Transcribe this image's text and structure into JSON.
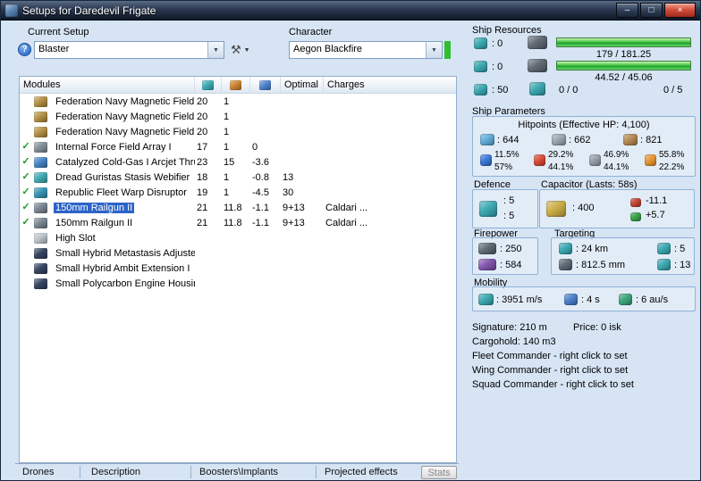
{
  "window": {
    "title": "Setups for Daredevil Frigate"
  },
  "glyphs": {
    "help": "?",
    "tools": "⚒",
    "dropdown": "▼",
    "minimize": "–",
    "maximize": "□",
    "close": "×"
  },
  "toolbar": {
    "current_setup_label": "Current Setup",
    "setup_value": "Blaster",
    "character_label": "Character",
    "character_value": "Aegon Blackfire"
  },
  "modules": {
    "header": {
      "name": "Modules",
      "optimal": "Optimal",
      "charges": "Charges"
    },
    "rows": [
      {
        "check": "",
        "icon_color": "#b08d3e",
        "name": "Federation Navy Magnetic Field ...",
        "cpu": "20",
        "pg": "1",
        "cap": "",
        "optimal": "",
        "charges": ""
      },
      {
        "check": "",
        "icon_color": "#b08d3e",
        "name": "Federation Navy Magnetic Field ...",
        "cpu": "20",
        "pg": "1",
        "cap": "",
        "optimal": "",
        "charges": ""
      },
      {
        "check": "",
        "icon_color": "#b08d3e",
        "name": "Federation Navy Magnetic Field ...",
        "cpu": "20",
        "pg": "1",
        "cap": "",
        "optimal": "",
        "charges": ""
      },
      {
        "check": "✓",
        "icon_color": "#7e8a93",
        "name": "Internal Force Field Array I",
        "cpu": "17",
        "pg": "1",
        "cap": "0",
        "optimal": "",
        "charges": ""
      },
      {
        "check": "✓",
        "icon_color": "#3f7fc2",
        "name": "Catalyzed Cold-Gas I Arcjet Thru...",
        "cpu": "23",
        "pg": "15",
        "cap": "-3.6",
        "optimal": "",
        "charges": ""
      },
      {
        "check": "✓",
        "icon_color": "#3aa7b0",
        "name": "Dread Guristas Stasis Webifier",
        "cpu": "18",
        "pg": "1",
        "cap": "-0.8",
        "optimal": "13",
        "charges": ""
      },
      {
        "check": "✓",
        "icon_color": "#2f8fb0",
        "name": "Republic Fleet Warp Disruptor",
        "cpu": "19",
        "pg": "1",
        "cap": "-4.5",
        "optimal": "30",
        "charges": ""
      },
      {
        "check": "✓",
        "icon_color": "#74828e",
        "name": "150mm Railgun II",
        "cpu": "21",
        "pg": "11.8",
        "cap": "-1.1",
        "optimal": "9+13",
        "charges": "Caldari ..."
      },
      {
        "check": "✓",
        "icon_color": "#74828e",
        "name": "150mm Railgun II",
        "cpu": "21",
        "pg": "11.8",
        "cap": "-1.1",
        "optimal": "9+13",
        "charges": "Caldari ..."
      },
      {
        "check": "",
        "icon_color": "#b9c2c9",
        "name": "High Slot",
        "cpu": "",
        "pg": "",
        "cap": "",
        "optimal": "",
        "charges": ""
      },
      {
        "check": "",
        "icon_color": "#2e3d5c",
        "name": "Small Hybrid Metastasis Adjuster I",
        "cpu": "",
        "pg": "",
        "cap": "",
        "optimal": "",
        "charges": ""
      },
      {
        "check": "",
        "icon_color": "#2e3d5c",
        "name": "Small Hybrid Ambit Extension I",
        "cpu": "",
        "pg": "",
        "cap": "",
        "optimal": "",
        "charges": ""
      },
      {
        "check": "",
        "icon_color": "#2e3d5c",
        "name": "Small Polycarbon Engine Housin...",
        "cpu": "",
        "pg": "",
        "cap": "",
        "optimal": "",
        "charges": ""
      }
    ]
  },
  "tabs": {
    "drones": "Drones",
    "description": "Description",
    "boosters": "Boosters\\Implants",
    "projected": "Projected effects",
    "stats": "Stats"
  },
  "resources": {
    "title": "Ship Resources",
    "turrets_free": ": 0",
    "launchers_free": ": 0",
    "calibration": ": 50",
    "cpu_text": "179 / 181.25",
    "powergrid_text": "44.52 / 45.06",
    "rigs_text": "0 / 0",
    "drones_text": "0 / 5"
  },
  "parameters": {
    "title": "Ship Parameters",
    "hitpoints_title": "Hitpoints (Effective HP: 4,100)",
    "shield_hp": ": 644",
    "armor_hp": ": 662",
    "structure_hp": ": 821",
    "resists": [
      {
        "shield": "11.5%",
        "armor": "57%"
      },
      {
        "shield": "29.2%",
        "armor": "44.1%"
      },
      {
        "shield": "46.9%",
        "armor": "44.1%"
      },
      {
        "shield": "55.8%",
        "armor": "22.2%"
      }
    ]
  },
  "defence": {
    "label": "Defence",
    "shield_recharge": ": 5",
    "armor_repair": ": 5"
  },
  "capacitor": {
    "label": "Capacitor (Lasts: 58s)",
    "capacity": ": 400",
    "drain": "-11.1",
    "recharge": "+5.7"
  },
  "firepower": {
    "label": "Firepower",
    "volley": ": 250",
    "dps": ": 584"
  },
  "targeting": {
    "label": "Targeting",
    "range": ": 24 km",
    "max_targets": ": 5",
    "scan_resolution": ": 812.5 mm",
    "sensor_strength": ": 13"
  },
  "mobility": {
    "label": "Mobility",
    "speed": ": 3951 m/s",
    "align_time": ": 4 s",
    "warp_speed": ": 6 au/s"
  },
  "info": {
    "signature": "Signature: 210 m",
    "price": "Price: 0 isk",
    "cargohold": "Cargohold: 140 m3",
    "fleet": "Fleet Commander - right click to set",
    "wing": "Wing Commander - right click to set",
    "squad": "Squad Commander - right click to set"
  },
  "icons": {
    "app": "#4a7ab0",
    "col_cpu": "#2fa3ad",
    "col_pg": "#c77a1f",
    "col_cap": "#3f78c8",
    "slot_turret": "#2fa3ad",
    "slot_launcher": "#2fa3ad",
    "slot_calibration": "#2fa3ad",
    "hardpoint_turret": "#55606c",
    "hardpoint_launcher": "#55606c",
    "rig_slot": "#2fa3ad",
    "shield": "#57a8d8",
    "armor": "#97a1ab",
    "structure": "#b08248",
    "em": "#2f6fd8",
    "thermal": "#d84028",
    "kinetic": "#8f99a3",
    "explosive": "#e89028",
    "defence": "#2fa3ad",
    "capacitor": "#c8a838",
    "cap_drain": "#c03828",
    "cap_boost": "#2f9f3f",
    "turret_fp": "#55606c",
    "dps": "#7a4aa8",
    "range": "#2fa3ad",
    "max_targets": "#2fa3ad",
    "scan_res": "#55606c",
    "sensor": "#2fa3ad",
    "speed": "#2fa3ad",
    "align": "#3f78c8",
    "warp": "#2f9f6f",
    "indicator_green": "#2fbf2f"
  }
}
